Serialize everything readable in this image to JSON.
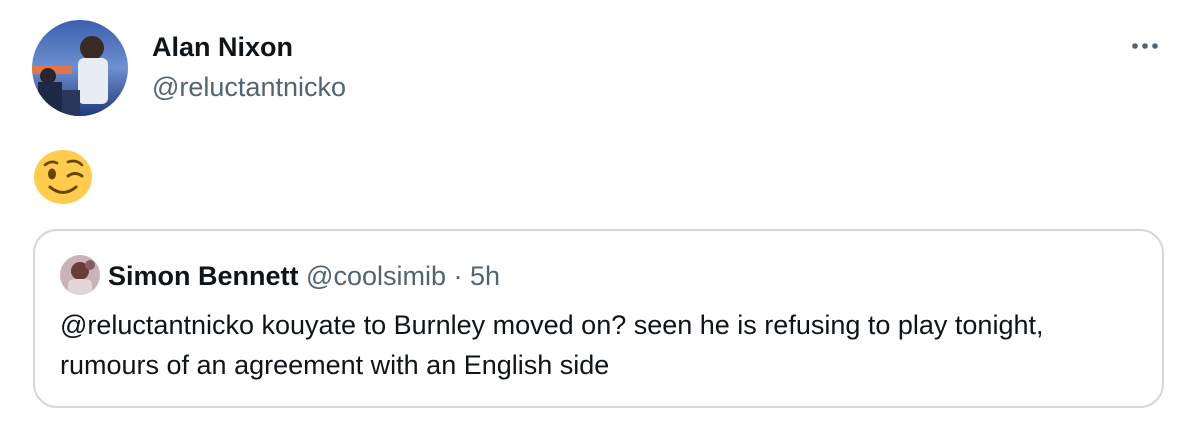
{
  "tweet": {
    "author": {
      "display_name": "Alan Nixon",
      "handle": "@reluctantnicko"
    },
    "more_icon": "ellipsis-icon",
    "body_emoji": "winking-face-emoji",
    "quoted": {
      "author": {
        "display_name": "Simon Bennett",
        "handle": "@coolsimib"
      },
      "separator": "·",
      "timestamp": "5h",
      "text": "@reluctantnicko kouyate to Burnley moved on? seen he is refusing to play tonight, rumours of an agreement with an English side"
    }
  },
  "colors": {
    "primary_text": "#0f1419",
    "secondary_text": "#536471",
    "border": "#cfd9de",
    "emoji_yellow": "#ffcc4d"
  }
}
